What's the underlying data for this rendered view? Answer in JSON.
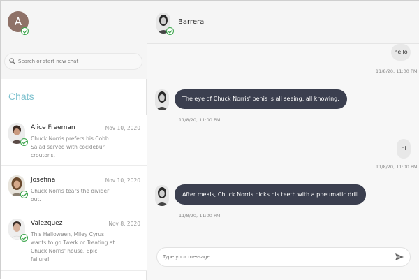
{
  "me": {
    "avatar_letter": "A"
  },
  "search": {
    "placeholder": "Search or start new chat"
  },
  "sidebar": {
    "title": "Chats",
    "chats": [
      {
        "name": "Alice Freeman",
        "date": "Nov 10, 2020",
        "preview": "Chuck Norris prefers his Cobb Salad served with cocklebur croutons."
      },
      {
        "name": "Josefina",
        "date": "Nov 10, 2020",
        "preview": "Chuck Norris tears the divider out."
      },
      {
        "name": "Valezquez",
        "date": "Nov 8, 2020",
        "preview": "This Halloween, Miley Cyrus wants to go Twerk or Treating at Chuck Norris' house. Epic failure!"
      }
    ]
  },
  "conversation": {
    "contact_name": "Barrera",
    "messages": [
      {
        "direction": "out",
        "text": "hello",
        "time": "11/8/20, 11:00 PM"
      },
      {
        "direction": "in",
        "text": "The eye of Chuck Norris' penis is all seeing, all knowing.",
        "time": "11/8/20, 11:00 PM"
      },
      {
        "direction": "out",
        "text": "hi",
        "time": "11/8/20, 11:00 PM"
      },
      {
        "direction": "in",
        "text": "After meals, Chuck Norris picks his teeth with a pneumatic drill",
        "time": "11/8/20, 11:00 PM"
      }
    ]
  },
  "composer": {
    "placeholder": "Type your message"
  },
  "colors": {
    "accent": "#7fc2cf",
    "online": "#3aa54a",
    "incoming_bubble": "#3b3f4f",
    "outgoing_bubble": "#e8e8e8"
  }
}
